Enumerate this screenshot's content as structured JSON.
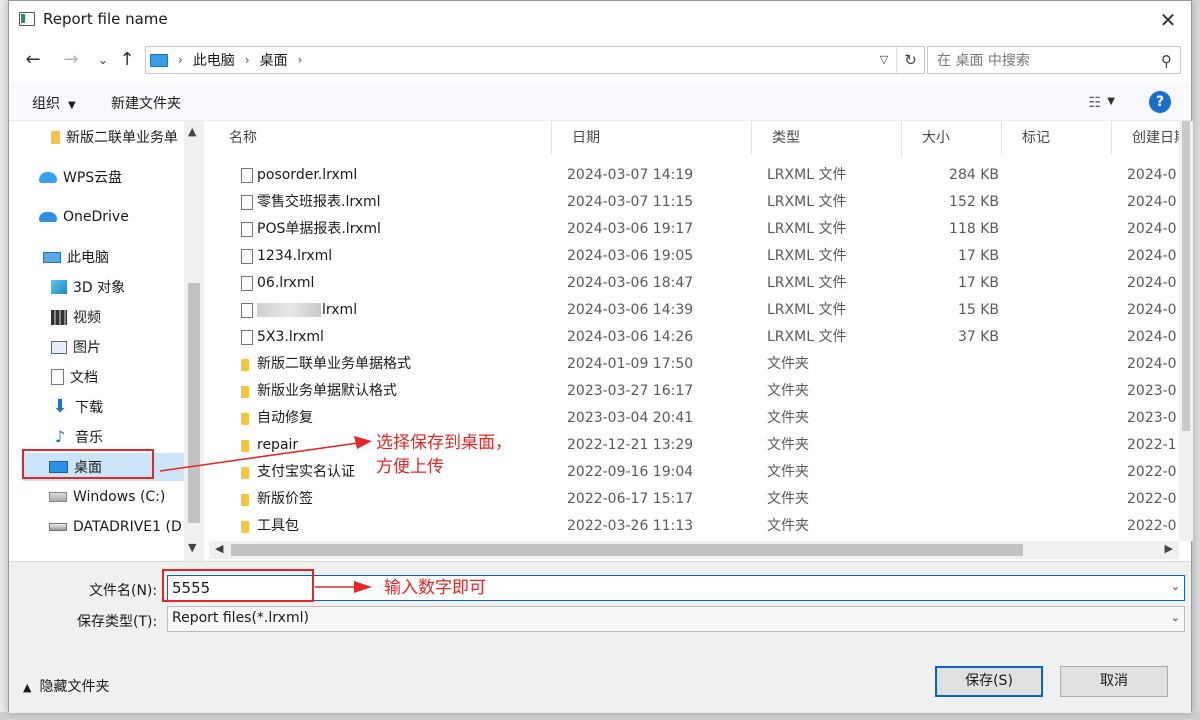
{
  "window": {
    "title": "Report file name"
  },
  "address": {
    "parts": [
      "此电脑",
      "桌面"
    ]
  },
  "search": {
    "placeholder": "在 桌面 中搜索"
  },
  "cmdbar": {
    "organize": "组织",
    "new_folder": "新建文件夹",
    "help": "?"
  },
  "nav": {
    "items": [
      {
        "label": "新版二联单业务单",
        "icon": "folder-icon"
      },
      {
        "label": "WPS云盘",
        "icon": "wps-cloud-icon"
      },
      {
        "label": "OneDrive",
        "icon": "onedrive-icon"
      },
      {
        "label": "此电脑",
        "icon": "pc-icon"
      },
      {
        "label": "3D 对象",
        "icon": "3d-objects-icon"
      },
      {
        "label": "视频",
        "icon": "video-icon"
      },
      {
        "label": "图片",
        "icon": "pictures-icon"
      },
      {
        "label": "文档",
        "icon": "documents-icon"
      },
      {
        "label": "下载",
        "icon": "download-icon"
      },
      {
        "label": "音乐",
        "icon": "music-icon"
      },
      {
        "label": "桌面",
        "icon": "desktop-icon"
      },
      {
        "label": "Windows (C:)",
        "icon": "windows-drive-icon"
      },
      {
        "label": "DATADRIVE1 (D",
        "icon": "drive-icon"
      }
    ]
  },
  "columns": [
    "名称",
    "日期",
    "类型",
    "大小",
    "标记",
    "创建日期"
  ],
  "files": [
    {
      "name": "posorder.lrxml",
      "date": "2024-03-07 14:19",
      "type": "LRXML 文件",
      "size": "284 KB",
      "created": "2024-0",
      "kind": "file"
    },
    {
      "name": "零售交班报表.lrxml",
      "date": "2024-03-07 11:15",
      "type": "LRXML 文件",
      "size": "152 KB",
      "created": "2024-0",
      "kind": "file"
    },
    {
      "name": "POS单据报表.lrxml",
      "date": "2024-03-06 19:17",
      "type": "LRXML 文件",
      "size": "118 KB",
      "created": "2024-0",
      "kind": "file"
    },
    {
      "name": "1234.lrxml",
      "date": "2024-03-06 19:05",
      "type": "LRXML 文件",
      "size": "17 KB",
      "created": "2024-0",
      "kind": "file"
    },
    {
      "name": "06.lrxml",
      "date": "2024-03-06 18:47",
      "type": "LRXML 文件",
      "size": "17 KB",
      "created": "2024-0",
      "kind": "file"
    },
    {
      "name": "lrxml",
      "date": "2024-03-06 14:39",
      "type": "LRXML 文件",
      "size": "15 KB",
      "created": "2024-0",
      "kind": "file-blurred"
    },
    {
      "name": "5X3.lrxml",
      "date": "2024-03-06 14:26",
      "type": "LRXML 文件",
      "size": "37 KB",
      "created": "2024-0",
      "kind": "file"
    },
    {
      "name": "新版二联单业务单据格式",
      "date": "2024-01-09 17:50",
      "type": "文件夹",
      "size": "",
      "created": "2024-0",
      "kind": "folder"
    },
    {
      "name": "新版业务单据默认格式",
      "date": "2023-03-27 16:17",
      "type": "文件夹",
      "size": "",
      "created": "2023-0",
      "kind": "folder"
    },
    {
      "name": "自动修复",
      "date": "2023-03-04 20:41",
      "type": "文件夹",
      "size": "",
      "created": "2023-0",
      "kind": "folder"
    },
    {
      "name": "repair",
      "date": "2022-12-21 13:29",
      "type": "文件夹",
      "size": "",
      "created": "2022-1",
      "kind": "folder"
    },
    {
      "name": "支付宝实名认证",
      "date": "2022-09-16 19:04",
      "type": "文件夹",
      "size": "",
      "created": "2022-0",
      "kind": "folder"
    },
    {
      "name": "新版价签",
      "date": "2022-06-17 15:17",
      "type": "文件夹",
      "size": "",
      "created": "2022-0",
      "kind": "folder"
    },
    {
      "name": "工具包",
      "date": "2022-03-26 11:13",
      "type": "文件夹",
      "size": "",
      "created": "2022-0",
      "kind": "folder"
    }
  ],
  "form": {
    "filename_label": "文件名(N):",
    "filename_value": "5555",
    "filetype_label": "保存类型(T):",
    "filetype_value": "Report files(*.lrxml)",
    "hide_folders": "隐藏文件夹",
    "save": "保存(S)",
    "cancel": "取消"
  },
  "annotations": {
    "desktop_note": "选择保存到桌面，\n方便上传",
    "filename_note": "输入数字即可",
    "color": "#e02828"
  }
}
